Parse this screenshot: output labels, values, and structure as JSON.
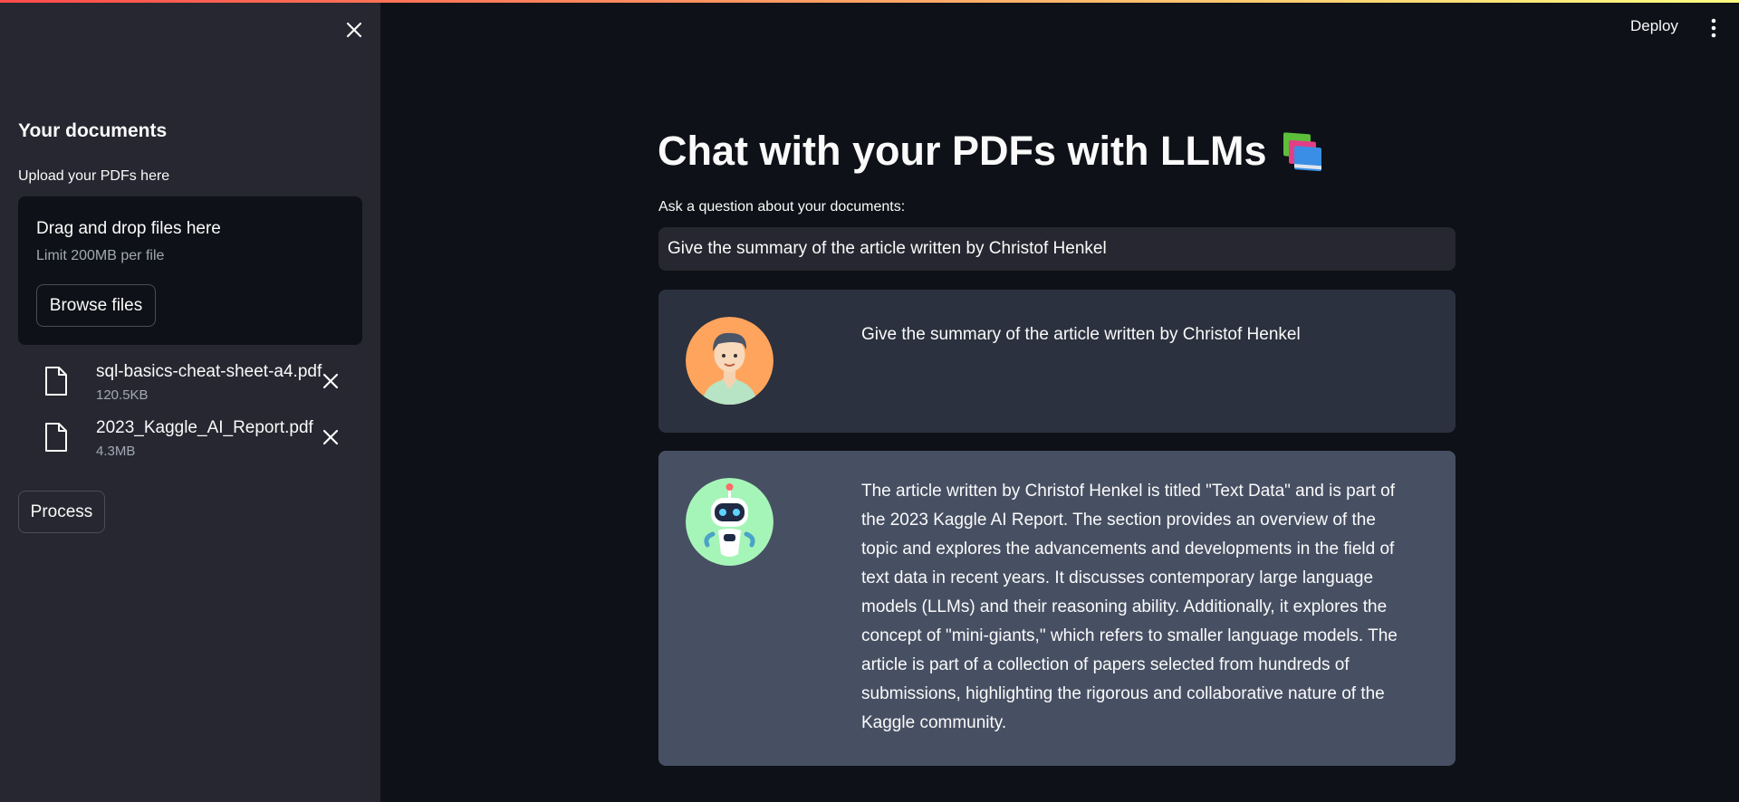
{
  "sidebar": {
    "title": "Your documents",
    "upload_label": "Upload your PDFs here",
    "dropzone": {
      "title": "Drag and drop files here",
      "limit": "Limit 200MB per file",
      "browse_label": "Browse files"
    },
    "files": [
      {
        "name": "sql-basics-cheat-sheet-a4.pdf",
        "size": "120.5KB"
      },
      {
        "name": "2023_Kaggle_AI_Report.pdf",
        "size": "4.3MB"
      }
    ],
    "process_label": "Process"
  },
  "header": {
    "deploy_label": "Deploy"
  },
  "main": {
    "title": "Chat with your PDFs with LLMs",
    "question_label": "Ask a question about your documents:",
    "question_value": "Give the summary of the article written by Christof Henkel",
    "messages": [
      {
        "role": "user",
        "text": "Give the summary of the article written by Christof Henkel"
      },
      {
        "role": "bot",
        "text": "The article written by Christof Henkel is titled \"Text Data\" and is part of the 2023 Kaggle AI Report. The section provides an overview of the topic and explores the advancements and developments in the field of text data in recent years. It discusses contemporary large language models (LLMs) and their reasoning ability. Additionally, it explores the concept of \"mini-giants,\" which refers to smaller language models. The article is part of a collection of papers selected from hundreds of submissions, highlighting the rigorous and collaborative nature of the Kaggle community."
      }
    ]
  },
  "colors": {
    "background": "#0e1117",
    "sidebar": "#262730",
    "user_message": "#2b313e",
    "bot_message": "#475063",
    "accent_gradient_start": "#ff4b4b",
    "accent_gradient_end": "#fffd80"
  },
  "icons": {
    "title_emoji": "books-icon",
    "user_avatar": "user-avatar",
    "bot_avatar": "robot-avatar"
  }
}
